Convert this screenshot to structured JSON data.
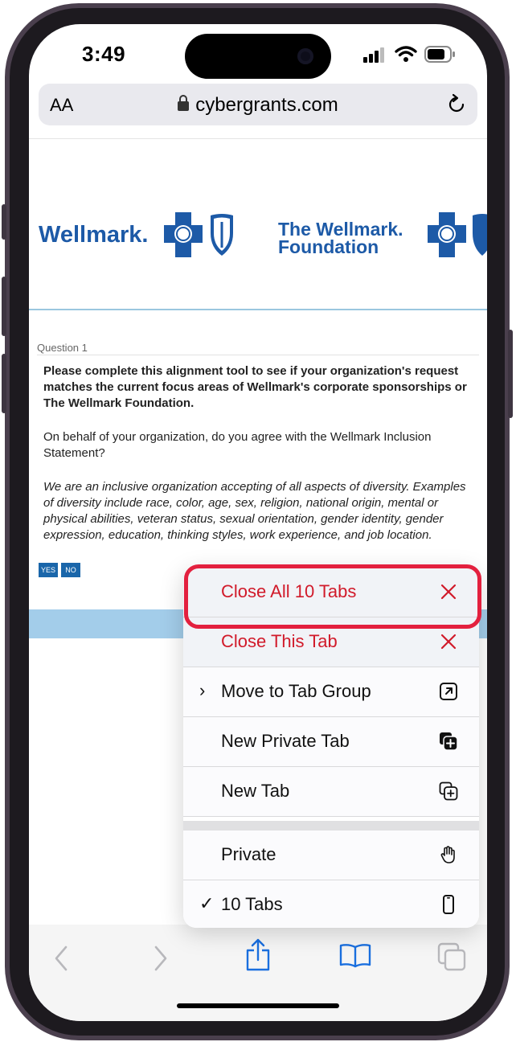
{
  "status_bar": {
    "time": "3:49"
  },
  "address_bar": {
    "text_size_label": "AA",
    "url": "cybergrants.com"
  },
  "page": {
    "logo_left": "Wellmark.",
    "logo_right_line1": "The Wellmark.",
    "logo_right_line2": "Foundation",
    "question_label": "Question 1",
    "question_bold": "Please complete this alignment tool to see if your organization's request matches the current focus areas of Wellmark's corporate sponsorships or The Wellmark Foundation.",
    "question_text": "On behalf of your organization, do you agree with the Wellmark Inclusion Statement?",
    "statement": "We are an inclusive organization accepting of all aspects of diversity. Examples of diversity include race, color, age, sex, religion, national origin, mental or physical abilities, veteran status, sexual orientation, gender identity, gender expression, education, thinking styles, work experience, and job location.",
    "yes_label": "YES",
    "no_label": "NO"
  },
  "menu": {
    "items": [
      {
        "label": "Close All 10 Tabs",
        "icon": "close-icon",
        "destructive": true
      },
      {
        "label": "Close This Tab",
        "icon": "close-icon",
        "destructive": true
      },
      {
        "label": "Move to Tab Group",
        "icon": "arrow-up-right-square-icon",
        "prefix": "›"
      },
      {
        "label": "New Private Tab",
        "icon": "plus-square-filled-icon"
      },
      {
        "label": "New Tab",
        "icon": "plus-square-on-square-icon"
      },
      {
        "label": "Private",
        "icon": "hand-icon"
      },
      {
        "label": "10 Tabs",
        "icon": "iphone-icon",
        "prefix": "✓"
      }
    ]
  },
  "colors": {
    "destructive": "#d11a2a",
    "accent": "#1a66aa",
    "highlight": "#e3203e",
    "brand": "#1d5aa7"
  }
}
